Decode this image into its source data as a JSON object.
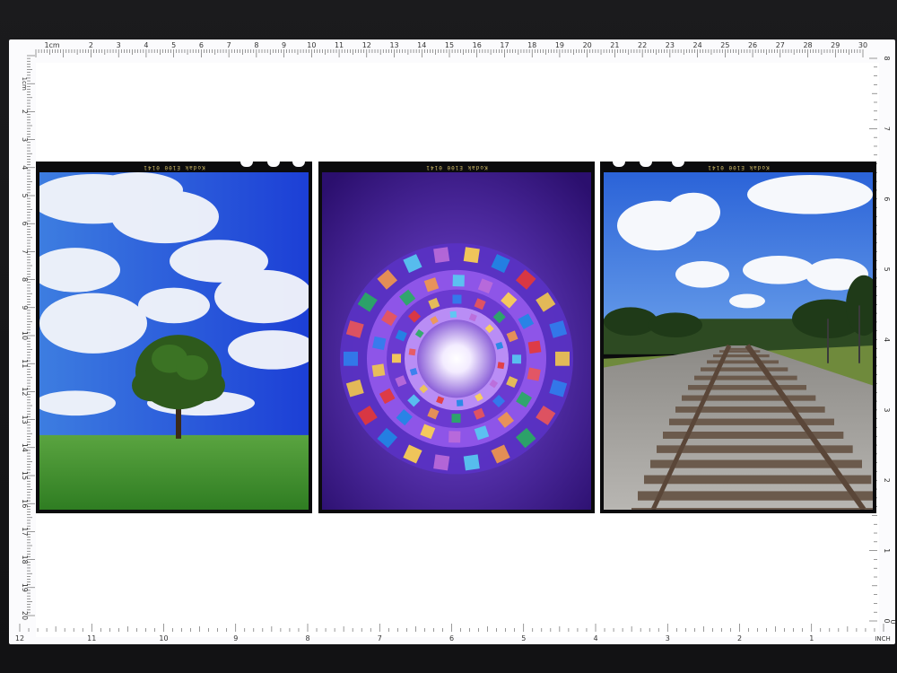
{
  "ruler": {
    "top_unit_label": "1cm",
    "top_ticks": [
      "2",
      "3",
      "4",
      "5",
      "6",
      "7",
      "8",
      "9",
      "10",
      "11",
      "12",
      "13",
      "14",
      "15",
      "16",
      "17",
      "18",
      "19",
      "20",
      "21",
      "22",
      "23",
      "24",
      "25",
      "26",
      "27",
      "28",
      "29",
      "30"
    ],
    "left_unit_label": "1cm",
    "left_ticks": [
      "2",
      "3",
      "4",
      "5",
      "6",
      "7",
      "8",
      "9",
      "10",
      "11",
      "12",
      "13",
      "14",
      "15",
      "16",
      "17",
      "18",
      "19",
      "20"
    ],
    "right_ticks": [
      "8",
      "7",
      "6",
      "5",
      "4",
      "3",
      "2",
      "1",
      "0"
    ],
    "bottom_ticks": [
      "12",
      "11",
      "10",
      "9",
      "8",
      "7",
      "6",
      "5",
      "4",
      "3",
      "2",
      "1"
    ],
    "bottom_unit_label": "INCH",
    "zero_label": "0"
  },
  "film": {
    "edge_print": [
      "Kodak E100 0141",
      "Kodak E100 0141",
      "Kodak E100 0141"
    ]
  },
  "photos": [
    {
      "subject": "tree-on-grass-field"
    },
    {
      "subject": "stained-glass-spiral"
    },
    {
      "subject": "railroad-tracks"
    }
  ]
}
